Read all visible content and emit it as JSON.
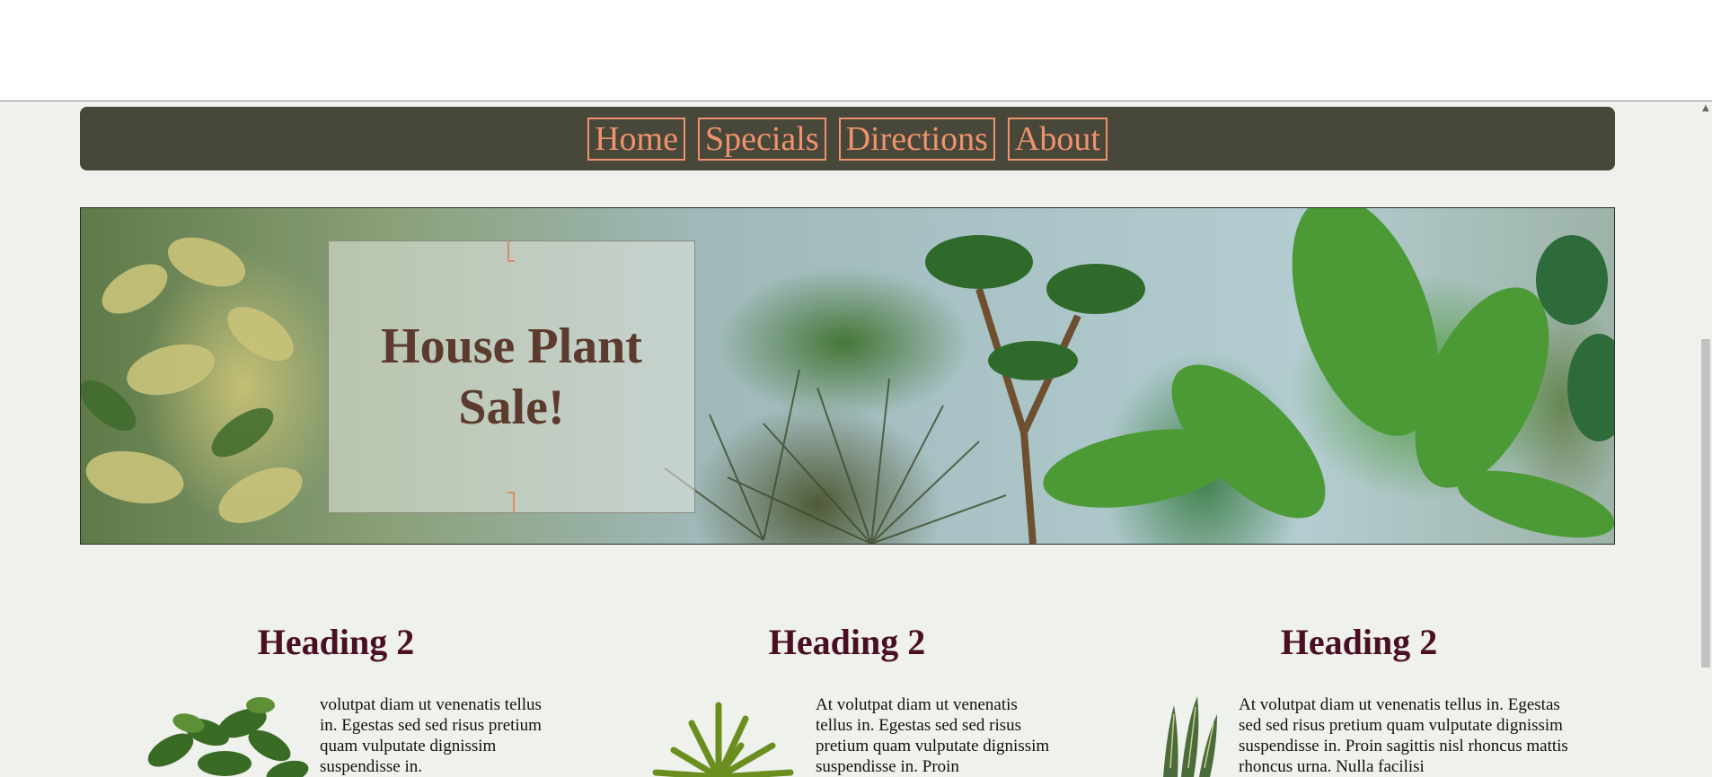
{
  "nav": {
    "items": [
      {
        "label": "Home"
      },
      {
        "label": "Specials"
      },
      {
        "label": "Directions"
      },
      {
        "label": "About"
      }
    ],
    "bg_color": "#47473a",
    "link_color": "#f0926c"
  },
  "hero": {
    "title": "House Plant Sale!",
    "title_color": "#5c3a2e"
  },
  "cards": [
    {
      "heading": "Heading 2",
      "text": "volutpat diam ut venenatis tellus in. Egestas sed sed risus pretium quam vulputate dignissim suspendisse in."
    },
    {
      "heading": "Heading 2",
      "text": "At volutpat diam ut venenatis tellus in. Egestas sed sed risus pretium quam vulputate dignissim suspendisse in. Proin"
    },
    {
      "heading": "Heading 2",
      "text": "At volutpat diam ut venenatis tellus in. Egestas sed sed risus pretium quam vulputate dignissim suspendisse in. Proin sagittis nisl rhoncus mattis rhoncus urna. Nulla facilisi"
    }
  ],
  "colors": {
    "page_bg": "#eef1ec",
    "heading": "#4a0f22"
  }
}
